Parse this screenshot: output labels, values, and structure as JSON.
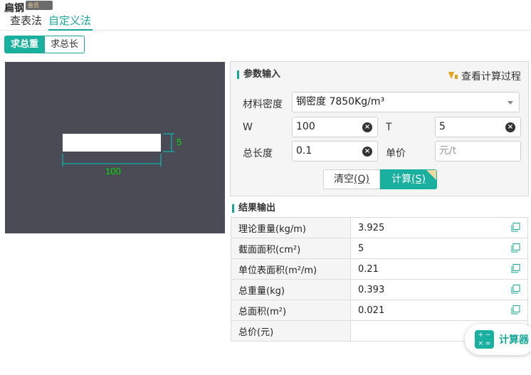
{
  "header": {
    "title": "扁钢",
    "badge": "会员"
  },
  "tabs": [
    {
      "label": "查表法"
    },
    {
      "label": "自定义法"
    }
  ],
  "mode": [
    {
      "label": "求总重"
    },
    {
      "label": "求总长"
    }
  ],
  "diagram": {
    "height_label": "5",
    "width_label": "100"
  },
  "input_panel": {
    "title": "参数输入",
    "calc_process": "查看计算过程",
    "density_label": "材料密度",
    "density_value": "钢密度 7850Kg/m³",
    "w_label": "W",
    "w_value": "100",
    "t_label": "T",
    "t_value": "5",
    "length_label": "总长度",
    "length_value": "0.1",
    "price_label": "单价",
    "price_placeholder": "元/t",
    "clear_label": "清空",
    "clear_key": "(Q)",
    "calc_label": "计算",
    "calc_key": "(S)"
  },
  "results": {
    "title": "结果输出",
    "rows": [
      {
        "label": "理论重量(kg/m)",
        "value": "3.925"
      },
      {
        "label": "截面面积(cm²)",
        "value": "5"
      },
      {
        "label": "单位表面积(m²/m)",
        "value": "0.21"
      },
      {
        "label": "总重量(kg)",
        "value": "0.393"
      },
      {
        "label": "总面积(m²)",
        "value": "0.021"
      },
      {
        "label": "总价(元)",
        "value": ""
      }
    ]
  },
  "calculator_button": {
    "label": "计算器"
  },
  "colors": {
    "accent": "#19b0a0",
    "canvas_bg": "#4a4b55",
    "dimension": "#00e000"
  }
}
